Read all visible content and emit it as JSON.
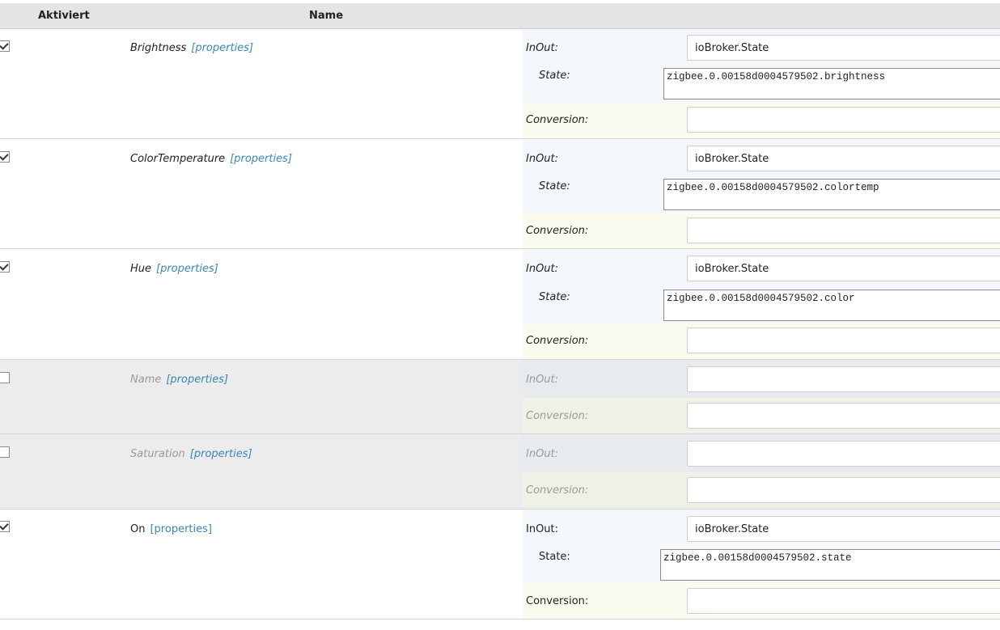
{
  "header": {
    "col_enabled": "Aktiviert",
    "col_name": "Name"
  },
  "labels": {
    "inout": "InOut:",
    "state": "State:",
    "conversion": "Conversion:",
    "properties": "[properties]"
  },
  "rows": [
    {
      "name": "Brightness",
      "enabled": true,
      "inout_value": "ioBroker.State",
      "state_value": "zigbee.0.00158d0004579502.brightness",
      "conversion_value": ""
    },
    {
      "name": "ColorTemperature",
      "enabled": true,
      "inout_value": "ioBroker.State",
      "state_value": "zigbee.0.00158d0004579502.colortemp",
      "conversion_value": ""
    },
    {
      "name": "Hue",
      "enabled": true,
      "inout_value": "ioBroker.State",
      "state_value": "zigbee.0.00158d0004579502.color",
      "conversion_value": ""
    },
    {
      "name": "Name",
      "enabled": false,
      "inout_value": "",
      "conversion_value": ""
    },
    {
      "name": "Saturation",
      "enabled": false,
      "inout_value": "",
      "conversion_value": ""
    },
    {
      "name": "On",
      "enabled": true,
      "inout_value": "ioBroker.State",
      "state_value": "zigbee.0.00158d0004579502.state",
      "conversion_value": ""
    }
  ]
}
